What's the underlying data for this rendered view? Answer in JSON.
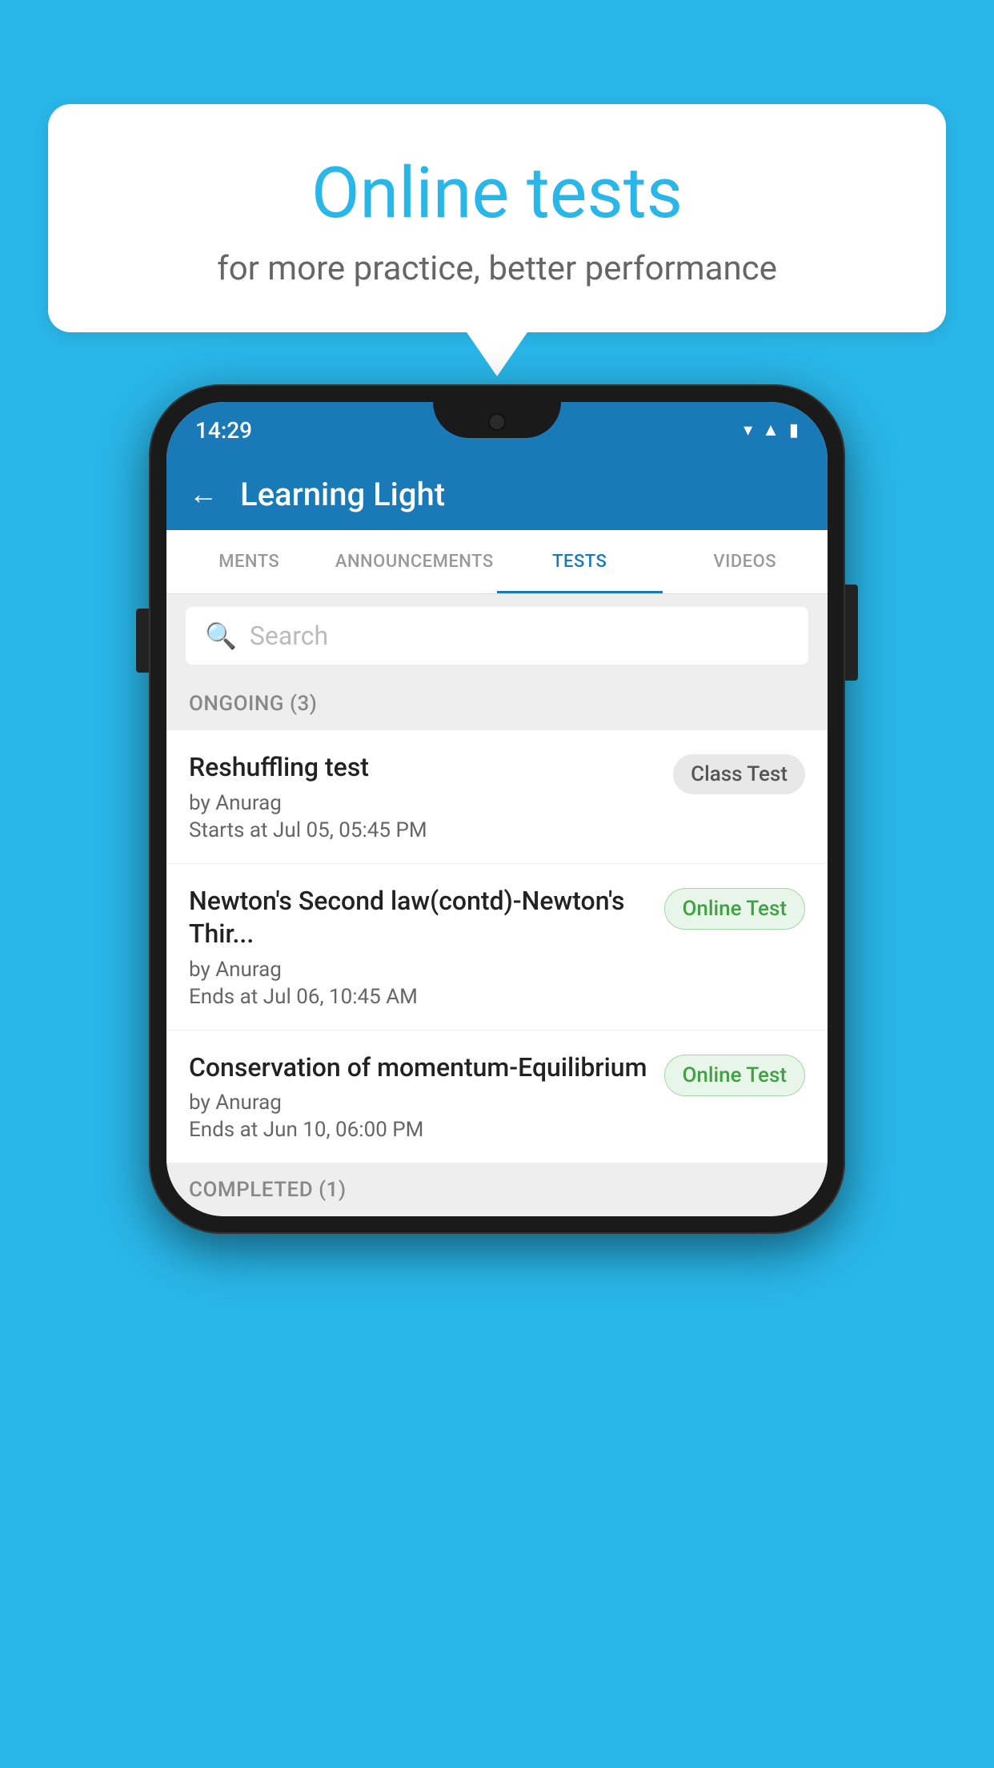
{
  "background": {
    "color": "#29b6e8"
  },
  "bubble": {
    "title": "Online tests",
    "subtitle": "for more practice, better performance"
  },
  "phone": {
    "status_bar": {
      "time": "14:29",
      "icons": [
        "wifi",
        "signal",
        "battery"
      ]
    },
    "app_bar": {
      "back_label": "←",
      "title": "Learning Light"
    },
    "tabs": [
      {
        "label": "MENTS",
        "active": false
      },
      {
        "label": "ANNOUNCEMENTS",
        "active": false
      },
      {
        "label": "TESTS",
        "active": true
      },
      {
        "label": "VIDEOS",
        "active": false
      }
    ],
    "search": {
      "placeholder": "Search"
    },
    "sections": [
      {
        "label": "ONGOING (3)",
        "items": [
          {
            "name": "Reshuffling test",
            "author": "by Anurag",
            "time_label": "Starts at",
            "time": "Jul 05, 05:45 PM",
            "badge": "Class Test",
            "badge_type": "class"
          },
          {
            "name": "Newton's Second law(contd)-Newton's Thir...",
            "author": "by Anurag",
            "time_label": "Ends at",
            "time": "Jul 06, 10:45 AM",
            "badge": "Online Test",
            "badge_type": "online"
          },
          {
            "name": "Conservation of momentum-Equilibrium",
            "author": "by Anurag",
            "time_label": "Ends at",
            "time": "Jun 10, 06:00 PM",
            "badge": "Online Test",
            "badge_type": "online"
          }
        ]
      }
    ],
    "bottom_section_label": "COMPLETED (1)"
  }
}
